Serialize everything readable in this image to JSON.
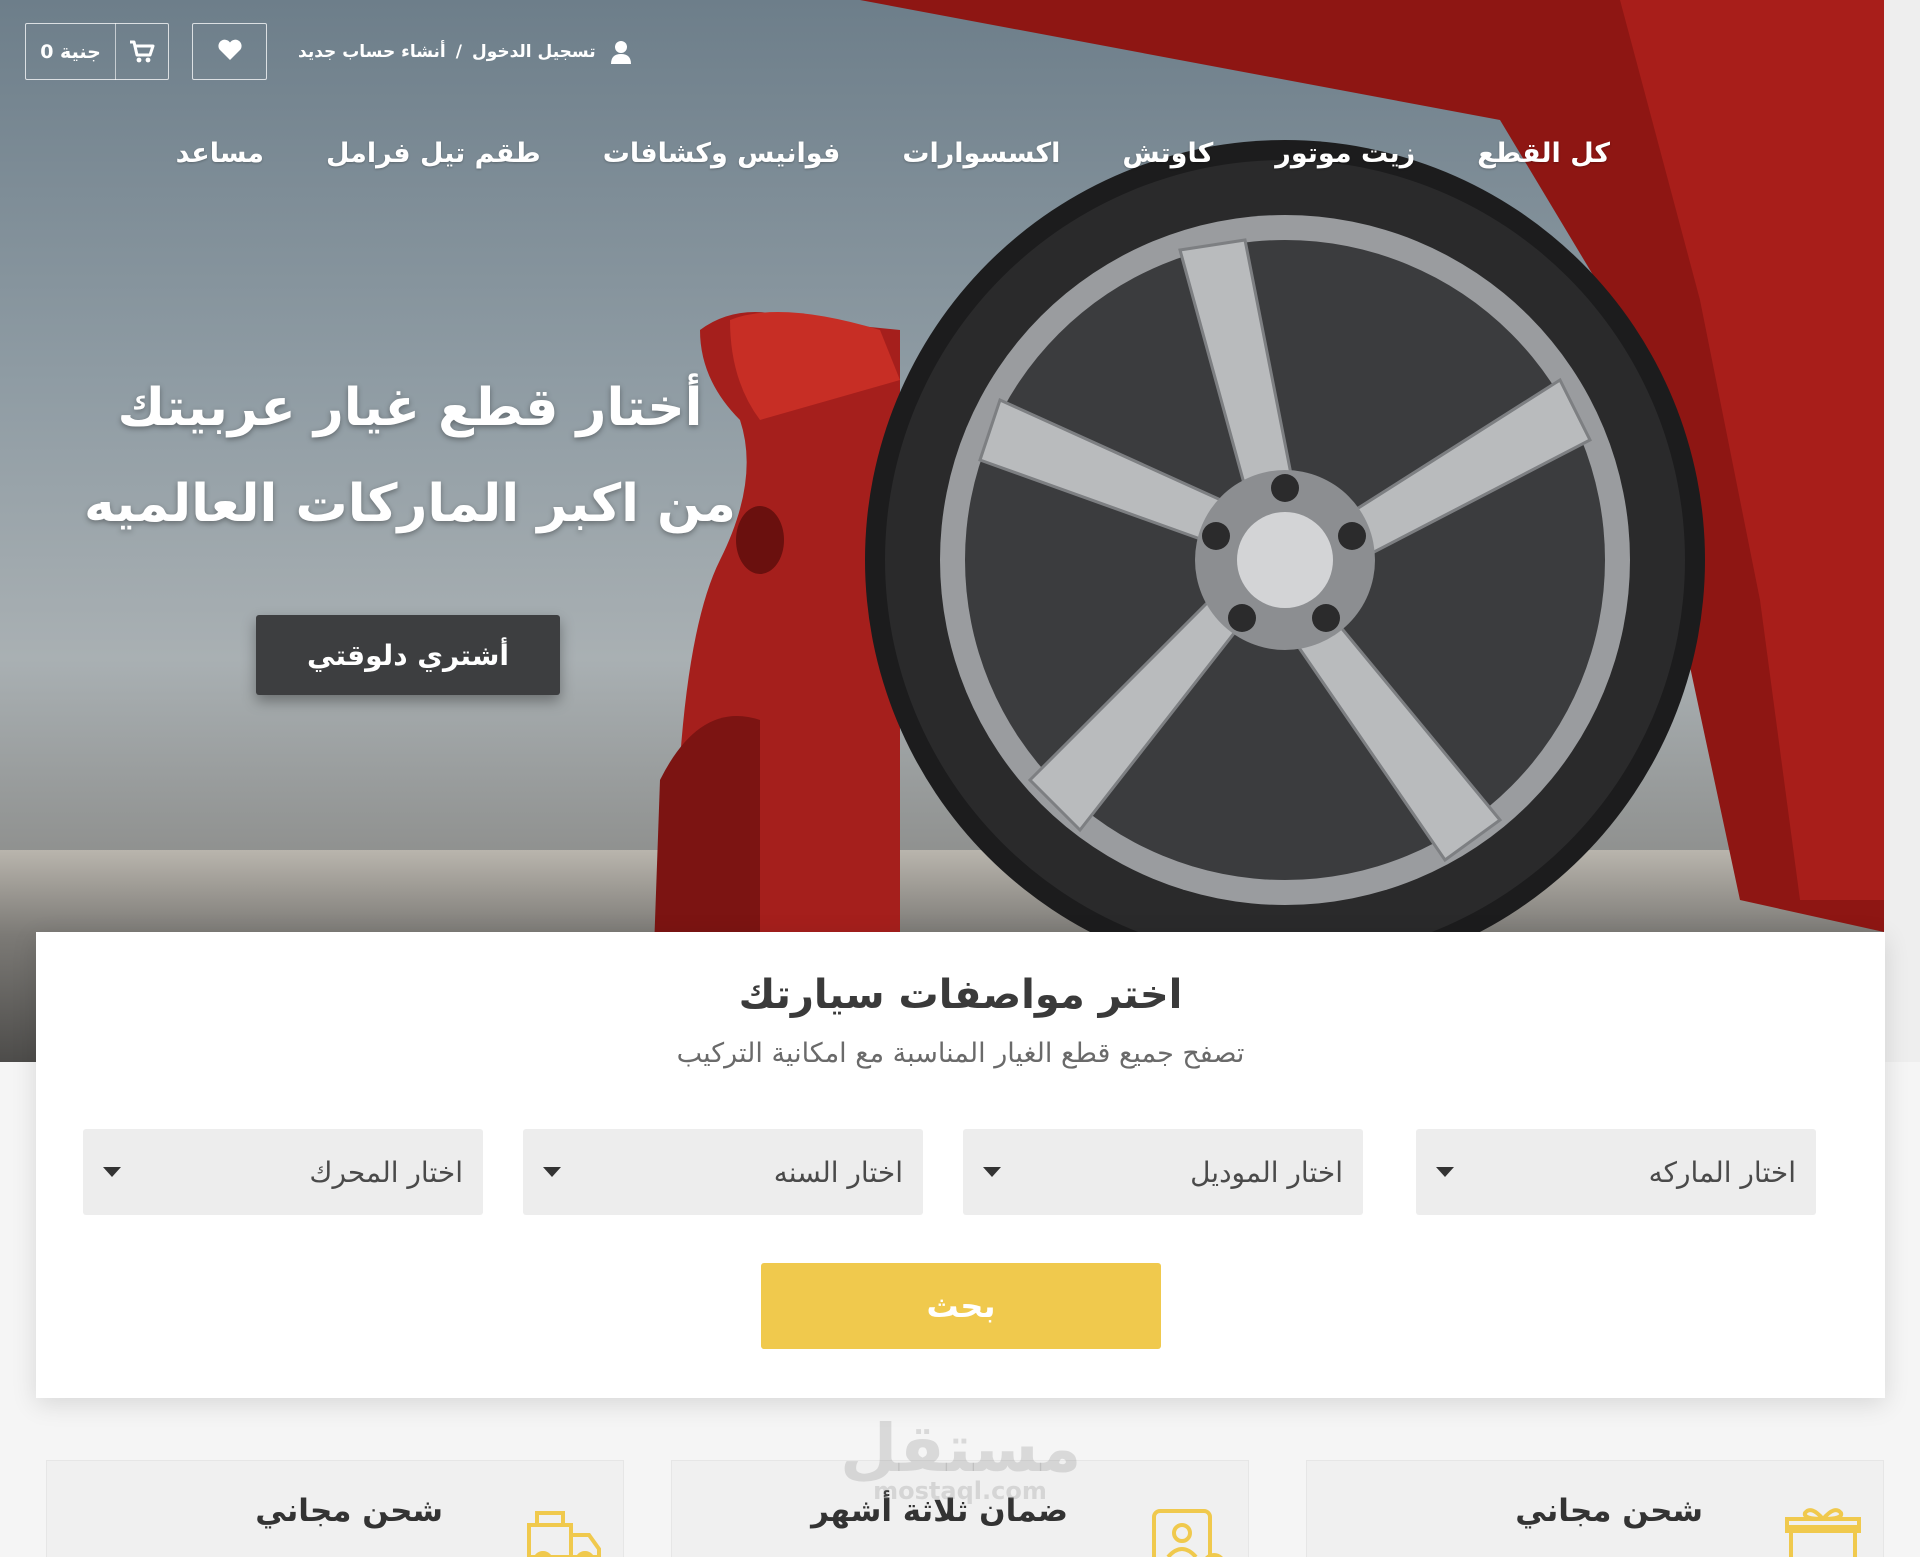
{
  "colors": {
    "accent_yellow": "#f0c94d",
    "dark_button": "#3d3e40",
    "car_red": "#b3221f",
    "panel_bg": "#ffffff",
    "select_bg": "#ededed"
  },
  "topbar": {
    "cart_total": "0 جنية",
    "cart_icon": "cart-icon",
    "wishlist_icon": "heart-icon",
    "user_icon": "user-icon",
    "login_label": "تسجيل الدخول",
    "separator": "/",
    "register_label": "أنشاء حساب جديد"
  },
  "nav": {
    "items": [
      {
        "label": "كل القطع"
      },
      {
        "label": "زيت موتور"
      },
      {
        "label": "كاوتش"
      },
      {
        "label": "اكسسوارات"
      },
      {
        "label": "فوانيس وكشافات"
      },
      {
        "label": "طقم تيل فرامل"
      },
      {
        "label": "مساعد"
      }
    ]
  },
  "hero": {
    "title_line1": "أختار قطع غيار عربيتك",
    "title_line2": "من اكبر الماركات العالميه",
    "cta_label": "أشتري دلوقتي"
  },
  "search": {
    "title": "اختر مواصفات سيارتك",
    "subtitle": "تصفح جميع قطع الغيار المناسبة مع امكانية التركيب",
    "selects": [
      {
        "label": "اختار الماركه"
      },
      {
        "label": "اختار الموديل"
      },
      {
        "label": "اختار السنه"
      },
      {
        "label": "اختار المحرك"
      }
    ],
    "button_label": "بحث"
  },
  "features": [
    {
      "title": "شحن مجاني",
      "icon": "gift-free-icon"
    },
    {
      "title": "ضمان ثلاثة أشهر",
      "icon": "certificate-icon"
    },
    {
      "title": "شحن مجاني",
      "icon": "delivery-truck-icon"
    }
  ],
  "watermark": {
    "text": "مستقل",
    "sub": "mostaql.com"
  }
}
